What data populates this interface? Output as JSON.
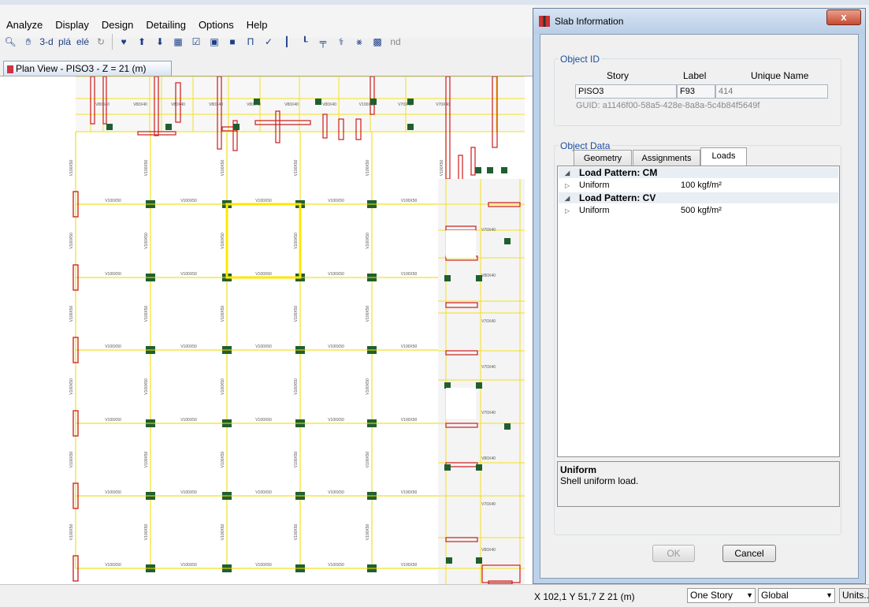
{
  "menu": [
    "Analyze",
    "Display",
    "Design",
    "Detailing",
    "Options",
    "Help"
  ],
  "toolbar": {
    "items": [
      "3-d",
      "plá",
      "elé",
      "nd"
    ]
  },
  "plan_tab": {
    "title": "Plan View - PISO3 - Z = 21 (m)"
  },
  "plan": {
    "top_labels": [
      "V80X40",
      "V80X40",
      "V80X40",
      "V80X40",
      "V80X40",
      "V80X40",
      "V80X40",
      "V100X50",
      "V70X40",
      "V70X40"
    ],
    "beam_label": "V100X50",
    "col_label": "V100X50",
    "right_labels": [
      "V70X40",
      "V80X40",
      "V70X40",
      "V70X40",
      "V70X40",
      "V80X40",
      "V70X40",
      "V80X40"
    ]
  },
  "dialog": {
    "title": "Slab Information",
    "close": "x",
    "object_id": {
      "group_label": "Object ID",
      "headers": {
        "story": "Story",
        "label": "Label",
        "unique_name": "Unique Name"
      },
      "story": "PISO3",
      "label": "F93",
      "unique_name": "414",
      "guid": "GUID:  a1146f00-58a5-428e-8a8a-5c4b84f5649f"
    },
    "object_data": {
      "group_label": "Object Data",
      "tabs": [
        "Geometry",
        "Assignments",
        "Loads"
      ],
      "active_tab": "Loads",
      "loads": [
        {
          "pattern": "Load Pattern: CM",
          "item": "Uniform",
          "value": "100 kgf/m²"
        },
        {
          "pattern": "Load Pattern: CV",
          "item": "Uniform",
          "value": "500 kgf/m²"
        }
      ],
      "description_title": "Uniform",
      "description_text": "Shell uniform load."
    },
    "ok": "OK",
    "cancel": "Cancel"
  },
  "status": {
    "coords": "X 102,1  Y 51,7  Z 21 (m)",
    "story_mode": "One Story",
    "coord_system": "Global",
    "units": "Units..."
  },
  "colors": {
    "beam": "#f2e020",
    "column": "#1f5f2f",
    "wall": "#cc1b1b",
    "selected": "#ffe600"
  }
}
